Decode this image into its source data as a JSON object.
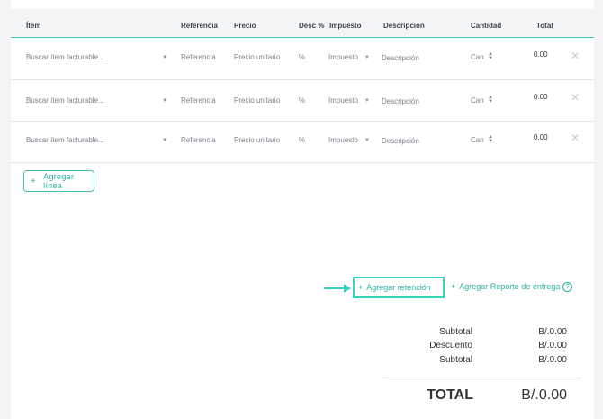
{
  "table": {
    "headers": [
      "Ítem",
      "Referencia",
      "Precio",
      "Desc %",
      "Impuesto",
      "Descripción",
      "Cantidad",
      "Total"
    ],
    "rows": [
      {
        "item_placeholder": "Buscar ítem facturable...",
        "reference_placeholder": "Referencia",
        "price_placeholder": "Precio unitario",
        "discount_placeholder": "%",
        "tax_placeholder": "Impuesto",
        "description_placeholder": "Descripción",
        "quantity_placeholder": "Can",
        "total": "0.00"
      },
      {
        "item_placeholder": "Buscar ítem facturable...",
        "reference_placeholder": "Referencia",
        "price_placeholder": "Precio unitario",
        "discount_placeholder": "%",
        "tax_placeholder": "Impuesto",
        "description_placeholder": "Descripción",
        "quantity_placeholder": "Can",
        "total": "0.00"
      },
      {
        "item_placeholder": "Buscar ítem facturable...",
        "reference_placeholder": "Referencia",
        "price_placeholder": "Precio unitario",
        "discount_placeholder": "%",
        "tax_placeholder": "Impuesto",
        "description_placeholder": "Descripción",
        "quantity_placeholder": "Can",
        "total": "0.00"
      }
    ]
  },
  "actions": {
    "add_line_plus": "+",
    "add_line": "Agregar línea",
    "add_retention_plus": "+",
    "add_retention": "Agregar retención",
    "add_delivery_plus": "+",
    "add_delivery_report": "Agregar Reporte de entrega",
    "help_glyph": "?"
  },
  "totals": {
    "subtotal_label": "Subtotal",
    "subtotal_value": "B/.0.00",
    "discount_label": "Descuento",
    "discount_value": "B/.0.00",
    "subtotal2_label": "Subtotal",
    "subtotal2_value": "B/.0.00",
    "total_label": "TOTAL",
    "total_value": "B/.0.00"
  },
  "icons": {
    "dropdown": "caret-down-icon",
    "stepper": "stepper-icon",
    "remove": "close-icon",
    "arrow": "arrow-right-icon"
  },
  "colors": {
    "accent": "#2bb3a3",
    "highlight": "#35d3c3"
  }
}
